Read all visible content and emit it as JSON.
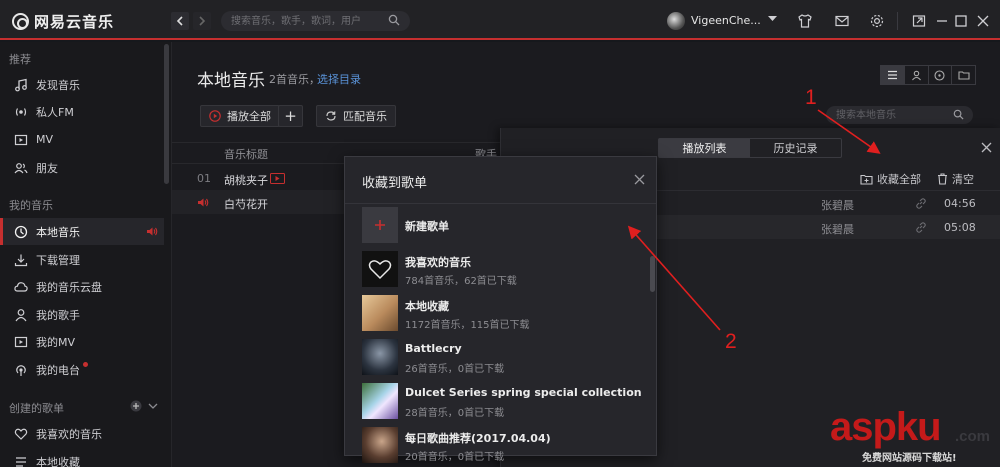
{
  "app": {
    "logo_text": "网易云音乐",
    "search_placeholder": "搜索音乐，歌手，歌词，用户",
    "username": "VigeenChe..."
  },
  "sidebar": {
    "sections": [
      {
        "title": "推荐",
        "items": [
          {
            "label": "发现音乐",
            "icon": "music-note-icon"
          },
          {
            "label": "私人FM",
            "icon": "radio-icon"
          },
          {
            "label": "MV",
            "icon": "video-icon"
          },
          {
            "label": "朋友",
            "icon": "friends-icon"
          }
        ]
      },
      {
        "title": "我的音乐",
        "items": [
          {
            "label": "本地音乐",
            "icon": "local-music-icon",
            "active": true
          },
          {
            "label": "下载管理",
            "icon": "download-icon"
          },
          {
            "label": "我的音乐云盘",
            "icon": "cloud-icon"
          },
          {
            "label": "我的歌手",
            "icon": "singer-icon"
          },
          {
            "label": "我的MV",
            "icon": "mv-icon"
          },
          {
            "label": "我的电台",
            "icon": "podcast-icon"
          }
        ]
      },
      {
        "title": "创建的歌单",
        "items": [
          {
            "label": "我喜欢的音乐",
            "icon": "heart-icon"
          },
          {
            "label": "本地收藏",
            "icon": "list-icon"
          }
        ]
      }
    ]
  },
  "main": {
    "title": "本地音乐",
    "song_count": "2首音乐，",
    "choose_dir": "选择目录",
    "play_all": "播放全部",
    "add": "+",
    "match": "匹配音乐",
    "search_placeholder": "搜索本地音乐",
    "columns": [
      "音乐标题",
      "歌手"
    ],
    "songs": [
      {
        "index": "01",
        "title": "胡桃夹子",
        "has_mv": true
      },
      {
        "index": "",
        "title": "白芍花开",
        "playing": true
      }
    ]
  },
  "playlist_panel": {
    "tabs": [
      "播放列表",
      "历史记录"
    ],
    "active_tab": 0,
    "collect_all": "收藏全部",
    "clear": "清空",
    "rows": [
      {
        "artist": "张碧晨",
        "duration": "04:56"
      },
      {
        "artist": "张碧晨",
        "duration": "05:08"
      }
    ]
  },
  "collect_dialog": {
    "title": "收藏到歌单",
    "new_playlist": "新建歌单",
    "playlists": [
      {
        "name": "我喜欢的音乐",
        "meta": "784首音乐，62首已下载"
      },
      {
        "name": "本地收藏",
        "meta": "1172首音乐，115首已下载"
      },
      {
        "name": "Battlecry",
        "meta": "26首音乐，0首已下载"
      },
      {
        "name": "Dulcet Series spring special collection",
        "meta": "28首音乐，0首已下载"
      },
      {
        "name": "每日歌曲推荐(2017.04.04)",
        "meta": "20首音乐，0首已下载"
      }
    ]
  },
  "annotations": {
    "label_1": "1",
    "label_2": "2"
  },
  "watermark": {
    "text": "aspku",
    "suffix": ".com",
    "subtitle": "免费网站源码下载站!"
  },
  "colors": {
    "accent": "#c62f2f",
    "link": "#5a93d8",
    "annotation": "#e01f1f"
  }
}
